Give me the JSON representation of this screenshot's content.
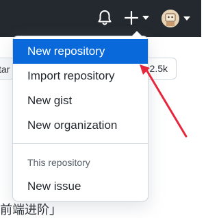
{
  "header": {
    "bell_icon": "bell-icon",
    "create_icon": "plus-icon",
    "avatar_icon": "avatar"
  },
  "background": {
    "left_button_text": "tar",
    "right_button_text": "2.5k",
    "content_text": "前端进阶」"
  },
  "create_menu": {
    "items": [
      {
        "label": "New repository",
        "active": true
      },
      {
        "label": "Import repository"
      },
      {
        "label": "New gist"
      },
      {
        "label": "New organization"
      }
    ],
    "section_label": "This repository",
    "section_items": [
      {
        "label": "New issue"
      }
    ]
  },
  "colors": {
    "header_bg": "#24292f",
    "active_item": "#0969da",
    "annotation_arrow": "#e5263b"
  }
}
